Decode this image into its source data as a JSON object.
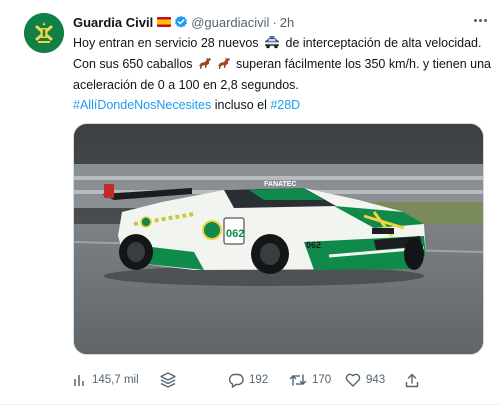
{
  "tweet": {
    "author_name": "Guardia Civil",
    "handle": "@guardiacivil",
    "separator": "·",
    "time": "2h",
    "text_lines": [
      [
        "Hoy entran en servicio 28 nuevos",
        "de interceptación de alta velocidad."
      ],
      [
        "Con sus 650 caballos",
        "superan fácilmente los 350 km/h. y tienen una"
      ],
      [
        "aceleración de 0 a 100 en 2,8 segundos."
      ]
    ],
    "hashtag_1": "#AllíDondeNosNecesites",
    "hashtag_mid": " incluso el ",
    "hashtag_2": "#28D",
    "emojis": [
      "police-car-emoji",
      "horse-emoji",
      "horse-emoji"
    ]
  },
  "media": {
    "car_text_1": "062",
    "car_text_2": "062",
    "car_brand": "FANATEC",
    "colors": {
      "car_body": "#f4f6f2",
      "car_green": "#0f8a4a",
      "track": "#6e7377",
      "wall": "#c9cccd"
    }
  },
  "actions": {
    "views": "145,7 mil",
    "replies": "192",
    "retweets": "170",
    "likes": "943"
  },
  "colors": {
    "accent": "#1d9bf0",
    "secondary_text": "#536471",
    "verified": "#1d9bf0"
  }
}
